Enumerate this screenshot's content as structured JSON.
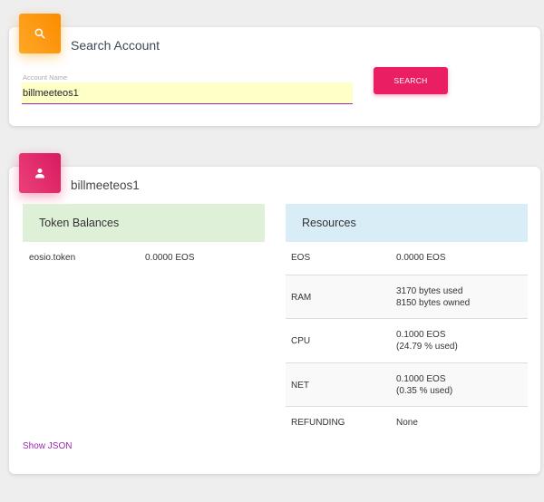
{
  "search": {
    "title": "Search Account",
    "field_label": "Account Name",
    "field_value": "billmeeteos1",
    "button_label": "SEARCH",
    "icon": "search-icon",
    "accent": "#ff9800"
  },
  "account": {
    "name": "billmeeteos1",
    "icon": "person-icon",
    "accent": "#e91e63",
    "token_balances": {
      "title": "Token Balances",
      "rows": [
        {
          "contract": "eosio.token",
          "amount": "0.0000 EOS"
        }
      ]
    },
    "resources": {
      "title": "Resources",
      "rows": [
        {
          "key": "EOS",
          "line1": "0.0000 EOS",
          "line2": ""
        },
        {
          "key": "RAM",
          "line1": "3170 bytes used",
          "line2": "8150 bytes owned"
        },
        {
          "key": "CPU",
          "line1": "0.1000 EOS",
          "line2": "(24.79 % used)"
        },
        {
          "key": "NET",
          "line1": "0.1000 EOS",
          "line2": "(0.35 % used)"
        },
        {
          "key": "REFUNDING",
          "line1": "None",
          "line2": ""
        }
      ]
    },
    "show_json": "Show JSON"
  },
  "colors": {
    "token_header_bg": "#dff0d8",
    "resources_header_bg": "#d9edf7",
    "button": "#e91e63",
    "link": "#9c27b0",
    "input_bg": "#ffffc8"
  }
}
